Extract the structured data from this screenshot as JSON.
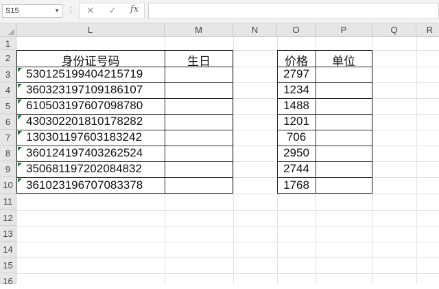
{
  "formula_bar": {
    "name_box": "S15",
    "cancel_glyph": "✕",
    "enter_glyph": "✓",
    "fx_label": "fx",
    "formula": ""
  },
  "columns": [
    "L",
    "M",
    "N",
    "O",
    "P",
    "Q",
    "R"
  ],
  "rows": [
    "1",
    "2",
    "3",
    "4",
    "5",
    "6",
    "7",
    "8",
    "9",
    "10",
    "11",
    "12",
    "13",
    "14",
    "15",
    "16"
  ],
  "table_left": {
    "headers": [
      "身份证号码",
      "生日"
    ],
    "ids": [
      "530125199404215719",
      "360323197109186107",
      "610503197607098780",
      "430302201810178282",
      "130301197603183242",
      "360124197403262524",
      "350681197202084832",
      "361023196707083378"
    ],
    "birthdays": [
      "",
      "",
      "",
      "",
      "",
      "",
      "",
      ""
    ]
  },
  "table_right": {
    "headers": [
      "价格",
      "单位"
    ],
    "prices": [
      "2797",
      "1234",
      "1488",
      "1201",
      "706",
      "2950",
      "2744",
      "1768"
    ],
    "units": [
      "",
      "",
      "",
      "",
      "",
      "",
      "",
      ""
    ]
  },
  "colors": {
    "header_bg": "#e6e6e6",
    "grid": "#e1e1e1",
    "border": "#222222",
    "error_tag": "#1e7a34"
  },
  "icons": {
    "cancel": "close-icon",
    "enter": "check-icon",
    "function": "fx-icon"
  }
}
